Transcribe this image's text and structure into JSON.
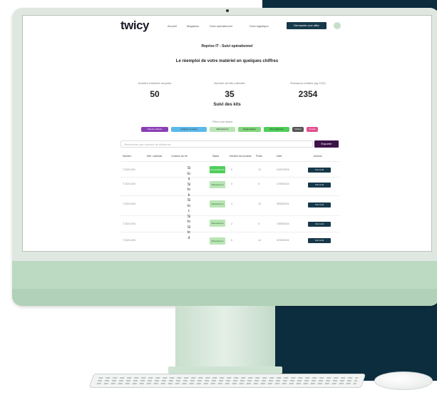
{
  "colors": {
    "navy": "#0c2d3e",
    "imac_green": "#bcd9c2",
    "nav_button": "#17384a",
    "export_button": "#3b1348"
  },
  "nav": {
    "logo": "twicy",
    "links": [
      "Accueil",
      "Magasins",
      "Suivi opérationnel",
      "Suivi logistique"
    ],
    "cta": "Demander une offre"
  },
  "page": {
    "breadcrumb_title": "Reprise IT - Suivi opérationnel",
    "headline": "Le réemploi de votre matériel en quelques chiffres",
    "stats": [
      {
        "label": "Nombre d'articles recyclés",
        "value": "50"
      },
      {
        "label": "Nombre de kits collectés",
        "value": "35"
      },
      {
        "label": "Émissions évitées (kg CO2)",
        "value": "2354"
      }
    ],
    "section_title": "Suivi des kits",
    "filter_label": "Filtrer par statut",
    "filters": [
      {
        "label": "Attente collecte",
        "color": "#8a3fb5"
      },
      {
        "label": "Collecte en cours",
        "color": "#5bb8e8"
      },
      {
        "label": "Réceptionné",
        "color": "#b9e5b5"
      },
      {
        "label": "Diagnostiqué",
        "color": "#7fd67a"
      },
      {
        "label": "Reconditionné",
        "color": "#4fcf5a"
      },
      {
        "label": "Clôturé",
        "color": "#555555"
      },
      {
        "label": "Annulé",
        "color": "#e0508c"
      }
    ],
    "search_placeholder": "Rechercher par numéro de référence",
    "export_label": "Exporter"
  },
  "table": {
    "headers": [
      "Numéro",
      "Site / adresse",
      "Contenu du kit",
      "Statut",
      "Nombre de produits",
      "Poids",
      "Date",
      "Actions"
    ],
    "rows": [
      {
        "ref": "T-2024-001",
        "status": "Reconditionné",
        "bright": true,
        "count": "5",
        "weight": "12",
        "date": "04/07/2024",
        "action": "Voir le kit"
      },
      {
        "ref": "T-2024-002",
        "status": "Réceptionné",
        "bright": false,
        "count": "3",
        "weight": "8",
        "date": "12/06/2024",
        "action": "Voir le kit"
      },
      {
        "ref": "T-2024-003",
        "status": "Réceptionné",
        "bright": false,
        "count": "4",
        "weight": "10",
        "date": "28/05/2024",
        "action": "Voir le kit"
      },
      {
        "ref": "T-2024-004",
        "status": "Réceptionné",
        "bright": false,
        "count": "2",
        "weight": "6",
        "date": "15/05/2024",
        "action": "Voir le kit"
      },
      {
        "ref": "T-2024-005",
        "status": "Réceptionné",
        "bright": false,
        "count": "6",
        "weight": "14",
        "date": "02/05/2024",
        "action": "Voir le kit"
      }
    ]
  },
  "vertical_text": [
    "Si",
    "to",
    "a",
    "Si",
    "to",
    "b",
    "Si",
    "to",
    "c",
    "Si",
    "to",
    "Si",
    "to",
    "d"
  ]
}
